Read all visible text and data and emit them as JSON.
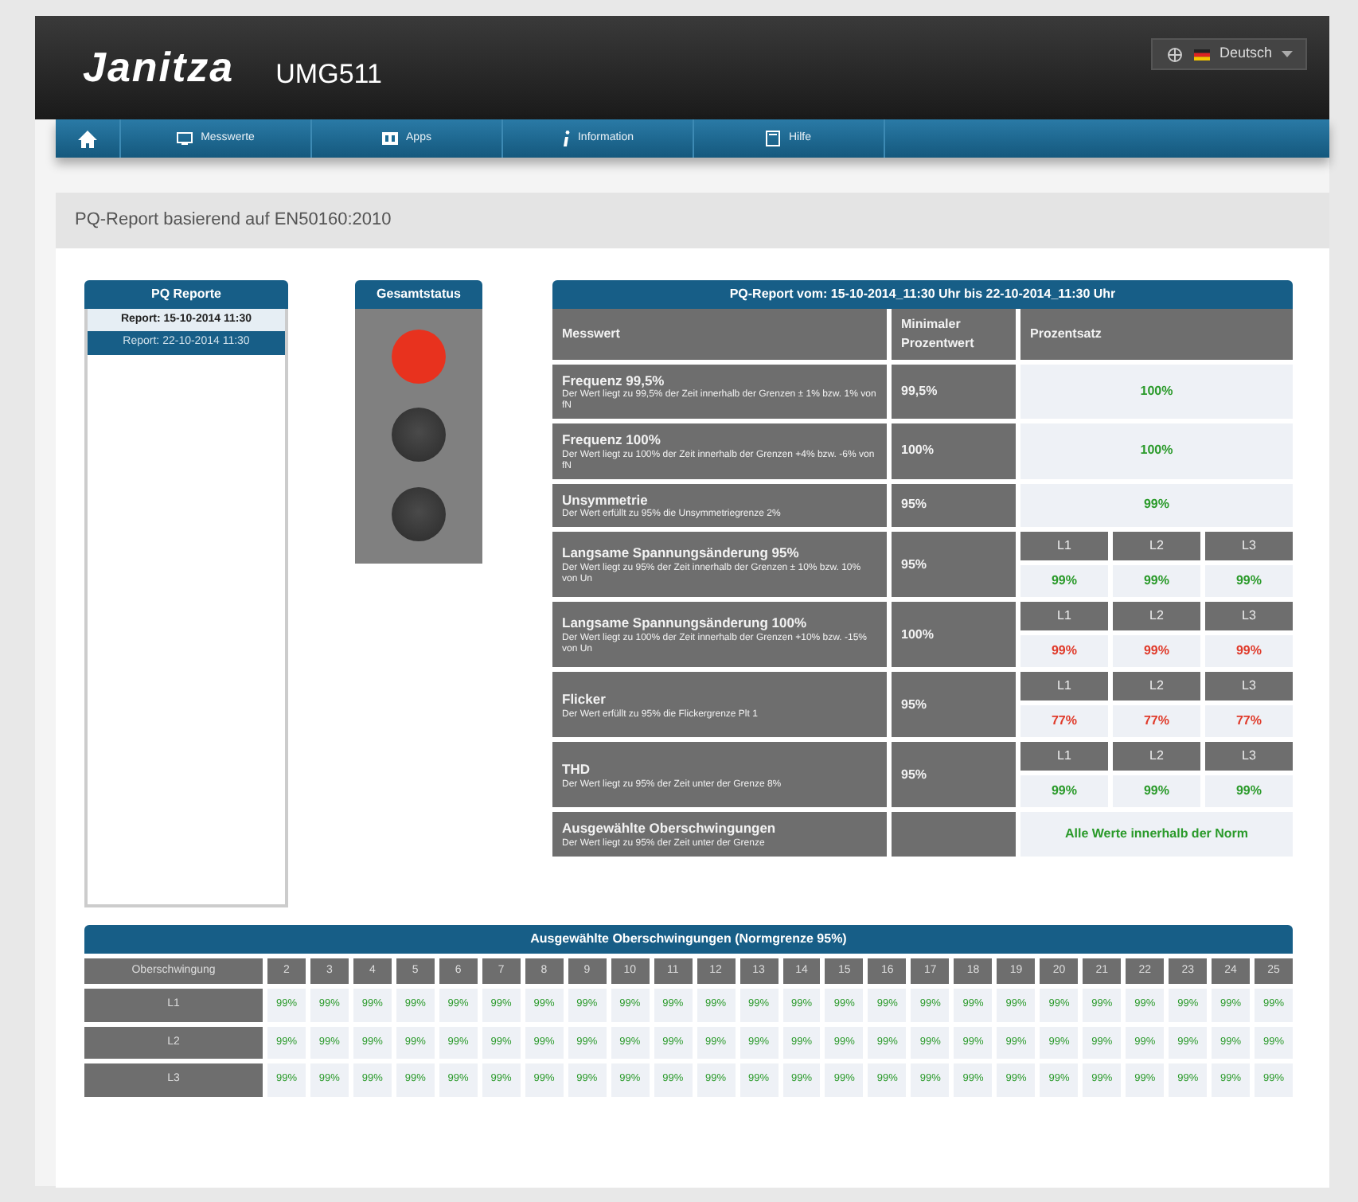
{
  "header": {
    "logo": "Janitza",
    "model": "UMG511",
    "language": "Deutsch"
  },
  "nav": [
    {
      "kind": "home"
    },
    {
      "kind": "monitor",
      "label": "Messwerte"
    },
    {
      "kind": "apps",
      "label": "Apps"
    },
    {
      "kind": "info",
      "label": "Information"
    },
    {
      "kind": "help",
      "label": "Hilfe"
    }
  ],
  "section_title": "PQ-Report basierend auf EN50160:2010",
  "reports": {
    "title": "PQ Reporte",
    "items": [
      {
        "label": "Report: 15-10-2014 11:30",
        "selected": false
      },
      {
        "label": "Report: 22-10-2014 11:30",
        "selected": true
      }
    ]
  },
  "status": {
    "title": "Gesamtstatus",
    "lamps": [
      {
        "lit": true
      },
      {
        "lit": false
      },
      {
        "lit": false
      }
    ]
  },
  "report": {
    "title": "PQ-Report vom: 15-10-2014_11:30 Uhr bis 22-10-2014_11:30 Uhr",
    "columns": [
      "Messwert",
      "Minimaler Prozentwert",
      "Prozentsatz"
    ],
    "rows": [
      {
        "name": "Frequenz 99,5%",
        "description": "Der Wert liegt zu 99,5% der Zeit innerhalb der Grenzen ± 1% bzw. 1% von fN",
        "minimum": "99,5%",
        "kind": "single",
        "result": {
          "value": "100%",
          "pass": true
        }
      },
      {
        "name": "Frequenz 100%",
        "description": "Der Wert liegt zu 100% der Zeit innerhalb der Grenzen +4% bzw. -6% von fN",
        "minimum": "100%",
        "kind": "single",
        "result": {
          "value": "100%",
          "pass": true
        }
      },
      {
        "name": "Unsymmetrie",
        "description": "Der Wert erfüllt zu 95% die Unsymmetriegrenze 2%",
        "minimum": "95%",
        "kind": "single",
        "result": {
          "value": "99%",
          "pass": true
        }
      },
      {
        "name": "Langsame Spannungsänderung 95%",
        "description": "Der Wert liegt zu 95% der Zeit innerhalb der Grenzen ± 10% bzw. 10% von Un",
        "minimum": "95%",
        "kind": "phases",
        "phases": [
          {
            "label": "L1",
            "value": "99%",
            "pass": true
          },
          {
            "label": "L2",
            "value": "99%",
            "pass": true
          },
          {
            "label": "L3",
            "value": "99%",
            "pass": true
          }
        ]
      },
      {
        "name": "Langsame Spannungsänderung 100%",
        "description": "Der Wert liegt zu 100% der Zeit innerhalb der Grenzen +10% bzw. -15% von Un",
        "minimum": "100%",
        "kind": "phases",
        "phases": [
          {
            "label": "L1",
            "value": "99%",
            "pass": false
          },
          {
            "label": "L2",
            "value": "99%",
            "pass": false
          },
          {
            "label": "L3",
            "value": "99%",
            "pass": false
          }
        ]
      },
      {
        "name": "Flicker",
        "description": "Der Wert erfüllt zu 95% die Flickergrenze Plt 1",
        "minimum": "95%",
        "kind": "phases",
        "phases": [
          {
            "label": "L1",
            "value": "77%",
            "pass": false
          },
          {
            "label": "L2",
            "value": "77%",
            "pass": false
          },
          {
            "label": "L3",
            "value": "77%",
            "pass": false
          }
        ]
      },
      {
        "name": "THD",
        "description": "Der Wert liegt zu 95% der Zeit unter der Grenze 8%",
        "minimum": "95%",
        "kind": "phases",
        "phases": [
          {
            "label": "L1",
            "value": "99%",
            "pass": true
          },
          {
            "label": "L2",
            "value": "99%",
            "pass": true
          },
          {
            "label": "L3",
            "value": "99%",
            "pass": true
          }
        ]
      },
      {
        "name": "Ausgewählte Oberschwingungen",
        "description": "Der Wert liegt zu 95% der Zeit unter der Grenze",
        "kind": "single",
        "result": {
          "value": "Alle Werte innerhalb der Norm",
          "pass": true
        }
      }
    ]
  },
  "harmonics": {
    "title": "Ausgewählte Oberschwingungen (Normgrenze 95%)",
    "corner": "Oberschwingung",
    "orders": [
      "2",
      "3",
      "4",
      "5",
      "6",
      "7",
      "8",
      "9",
      "10",
      "11",
      "12",
      "13",
      "14",
      "15",
      "16",
      "17",
      "18",
      "19",
      "20",
      "21",
      "22",
      "23",
      "24",
      "25"
    ],
    "rows": [
      {
        "label": "L1",
        "values": [
          "99%",
          "99%",
          "99%",
          "99%",
          "99%",
          "99%",
          "99%",
          "99%",
          "99%",
          "99%",
          "99%",
          "99%",
          "99%",
          "99%",
          "99%",
          "99%",
          "99%",
          "99%",
          "99%",
          "99%",
          "99%",
          "99%",
          "99%",
          "99%"
        ]
      },
      {
        "label": "L2",
        "values": [
          "99%",
          "99%",
          "99%",
          "99%",
          "99%",
          "99%",
          "99%",
          "99%",
          "99%",
          "99%",
          "99%",
          "99%",
          "99%",
          "99%",
          "99%",
          "99%",
          "99%",
          "99%",
          "99%",
          "99%",
          "99%",
          "99%",
          "99%",
          "99%"
        ]
      },
      {
        "label": "L3",
        "values": [
          "99%",
          "99%",
          "99%",
          "99%",
          "99%",
          "99%",
          "99%",
          "99%",
          "99%",
          "99%",
          "99%",
          "99%",
          "99%",
          "99%",
          "99%",
          "99%",
          "99%",
          "99%",
          "99%",
          "99%",
          "99%",
          "99%",
          "99%",
          "99%"
        ]
      }
    ]
  }
}
